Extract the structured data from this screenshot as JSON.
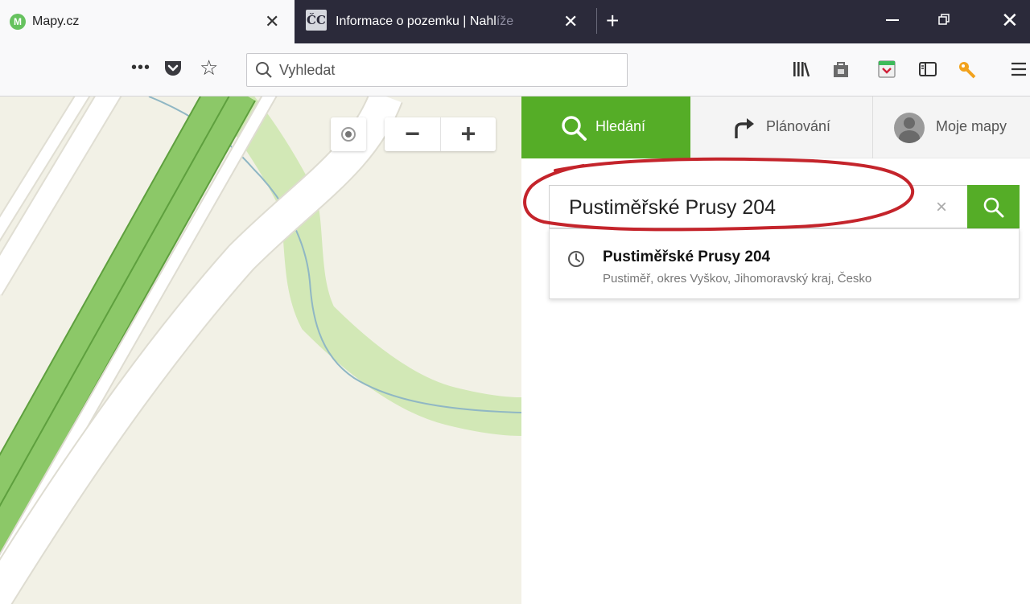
{
  "browser": {
    "tabs": [
      {
        "title": "Mapy.cz",
        "favicon_letter": "M"
      },
      {
        "title": "Informace o pozemku | Nahlíže",
        "title_visible": "Informace o pozemku | Nahl",
        "title_faded": "íže",
        "favicon_text": "ČC"
      }
    ],
    "search_placeholder": "Vyhledat",
    "more_dots": "•••"
  },
  "map": {
    "zoom_out_label": "−",
    "zoom_in_label": "+"
  },
  "panel": {
    "tabs": [
      {
        "label": "Hledání",
        "active": true
      },
      {
        "label": "Plánování",
        "active": false
      },
      {
        "label": "Moje mapy",
        "active": false
      }
    ],
    "search_value": "Pustiměřské Prusy 204",
    "clear_label": "×",
    "suggestion": {
      "title": "Pustiměřské Prusy 204",
      "subtitle": "Pustiměř, okres Vyškov, Jihomoravský kraj, Česko"
    }
  },
  "colors": {
    "brand_green": "#55ad27",
    "tabbar_dark": "#2b2a3a",
    "annotation_red": "#c4242b"
  }
}
